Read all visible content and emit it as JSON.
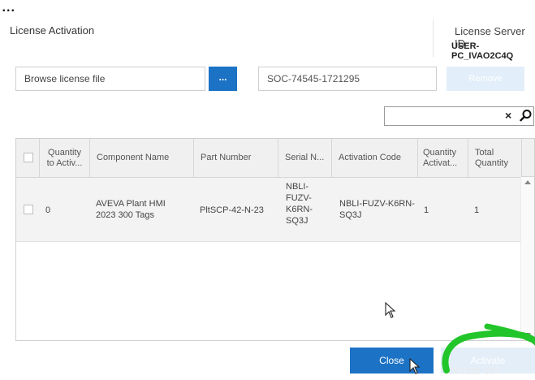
{
  "top_fragment": "...",
  "dialog": {
    "title": "License Activation",
    "license_server_label": "License Server ID",
    "license_server_value": "USER-PC_IVAO2C4Q"
  },
  "browse": {
    "field_label": "Browse license file",
    "button_label": "..."
  },
  "activation_code": {
    "value": "SOC-74545-1721295"
  },
  "remove_button": {
    "label": "Remove"
  },
  "search": {
    "value": "",
    "clear_glyph": "×"
  },
  "table": {
    "headers": {
      "quantity_to_activate": [
        "Quantity",
        "to Activ..."
      ],
      "component_name": "Component Name",
      "part_number": "Part Number",
      "serial_number": "Serial N...",
      "activation_code": "Activation Code",
      "quantity_activated": [
        "Quantity",
        "Activat..."
      ],
      "total_quantity": [
        "Total",
        "Quantity"
      ]
    },
    "rows": [
      {
        "quantity_to_activate": "0",
        "component_name": [
          "AVEVA Plant HMI",
          "2023 300 Tags"
        ],
        "part_number": "PltSCP-42-N-23",
        "serial_number": [
          "NBLI-",
          "FUZV-",
          "K6RN-",
          "SQ3J"
        ],
        "activation_code": [
          "NBLI-FUZV-K6RN-",
          "SQ3J"
        ],
        "quantity_activated": "1",
        "total_quantity": "1"
      }
    ]
  },
  "footer": {
    "close_label": "Close",
    "activate_label": "Activate",
    "watermark_text": "ctivate Wi"
  },
  "colors": {
    "accent": "#1c73c5",
    "disabled_button": "#e2eef9",
    "annotation": "#22c52a"
  },
  "icons": [
    "search-icon",
    "mouse-cursor-icon",
    "scroll-up-icon",
    "scroll-down-icon"
  ]
}
